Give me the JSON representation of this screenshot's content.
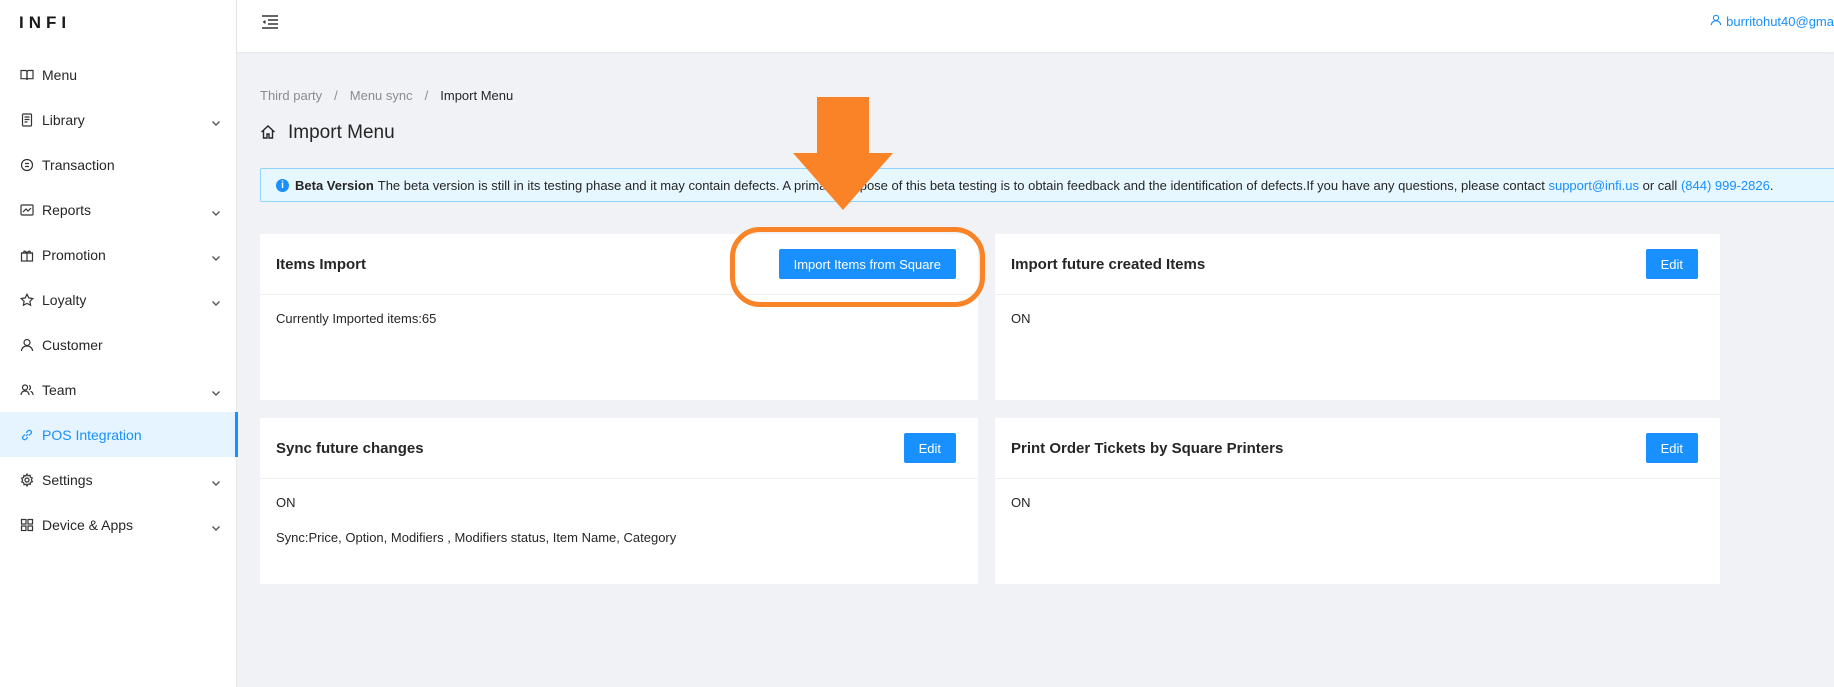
{
  "brand": {
    "logo_text": "INFI"
  },
  "header": {
    "user_email": "burritohut40@gma"
  },
  "sidebar": {
    "items": [
      {
        "label": "Menu",
        "icon": "book-icon",
        "has_children": false
      },
      {
        "label": "Library",
        "icon": "library-icon",
        "has_children": true
      },
      {
        "label": "Transaction",
        "icon": "transaction-icon",
        "has_children": false
      },
      {
        "label": "Reports",
        "icon": "chart-icon",
        "has_children": true
      },
      {
        "label": "Promotion",
        "icon": "gift-icon",
        "has_children": true
      },
      {
        "label": "Loyalty",
        "icon": "star-icon",
        "has_children": true
      },
      {
        "label": "Customer",
        "icon": "user-icon",
        "has_children": false
      },
      {
        "label": "Team",
        "icon": "team-icon",
        "has_children": true
      },
      {
        "label": "POS Integration",
        "icon": "link-icon",
        "has_children": false,
        "active": true
      },
      {
        "label": "Settings",
        "icon": "gear-icon",
        "has_children": true
      },
      {
        "label": "Device & Apps",
        "icon": "grid-icon",
        "has_children": true
      }
    ]
  },
  "breadcrumb": {
    "items": [
      "Third party",
      "Menu sync",
      "Import Menu"
    ],
    "separator": "/"
  },
  "page": {
    "title": "Import Menu"
  },
  "alert": {
    "title": "Beta Version",
    "text": "The beta version is still in its testing phase and it may contain defects. A primary purpose of this beta testing is to obtain feedback and the identification of defects.If you have any questions, please contact",
    "email": "support@infi.us",
    "mid": "or call",
    "phone": "(844) 999-2826",
    "end": "."
  },
  "cards": {
    "items_import": {
      "title": "Items Import",
      "button": "Import Items from Square",
      "line1": "Currently Imported items:65"
    },
    "future_items": {
      "title": "Import future created Items",
      "button": "Edit",
      "line1": "ON"
    },
    "sync_changes": {
      "title": "Sync future changes",
      "button": "Edit",
      "line1": "ON",
      "line2": "Sync:Price, Option, Modifiers , Modifiers status, Item Name, Category"
    },
    "print_tickets": {
      "title": "Print Order Tickets by Square Printers",
      "button": "Edit",
      "line1": "ON"
    }
  },
  "colors": {
    "accent": "#1890ff",
    "annotation": "#f98326",
    "active_bg": "#e6f4ff"
  }
}
